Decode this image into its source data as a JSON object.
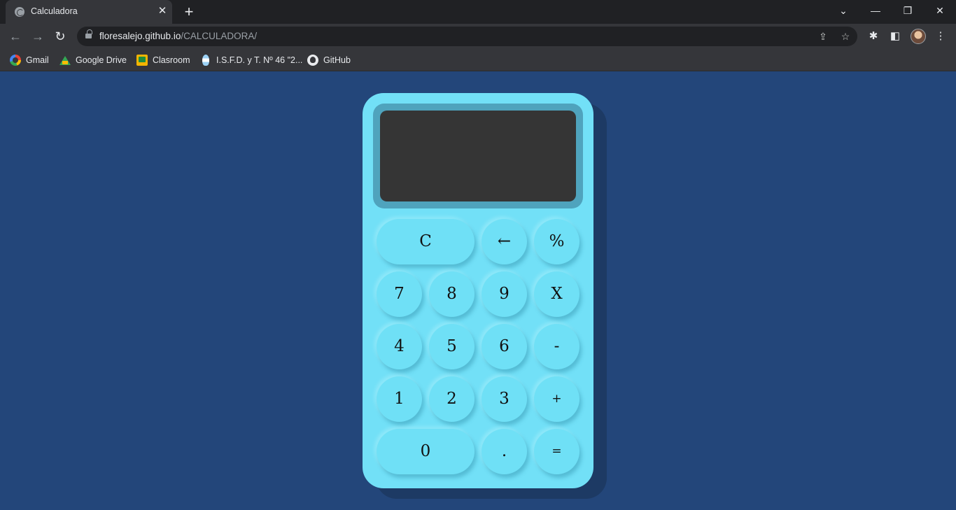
{
  "browser": {
    "tab_title": "Calculadora",
    "tab_close": "✕",
    "new_tab": "+",
    "window": {
      "dropdown": "⌄",
      "minimize": "—",
      "restore": "❐",
      "close": "✕"
    },
    "nav": {
      "back": "←",
      "forward": "→",
      "reload": "↻"
    },
    "url_host": "floresalejo.github.io",
    "url_path": "/CALCULADORA/",
    "omnibox_icons": {
      "share": "⇪",
      "star": "☆"
    },
    "toolbar_icons": {
      "extensions": "✱",
      "side_panel": "◧",
      "menu": "⋮"
    },
    "bookmarks": [
      {
        "label": "Gmail",
        "icon": "google-icon"
      },
      {
        "label": "Google Drive",
        "icon": "google-drive-icon"
      },
      {
        "label": "Clasroom",
        "icon": "classroom-icon"
      },
      {
        "label": "I.S.F.D. y T. Nº 46 \"2...",
        "icon": "isfd-icon"
      },
      {
        "label": "GitHub",
        "icon": "github-icon"
      }
    ]
  },
  "calculator": {
    "display": "",
    "keys": {
      "clear": "C",
      "backspace": "←",
      "percent": "%",
      "seven": "7",
      "eight": "8",
      "nine": "9",
      "multiply": "X",
      "four": "4",
      "five": "5",
      "six": "6",
      "subtract": "-",
      "one": "1",
      "two": "2",
      "three": "3",
      "add": "+",
      "zero": "0",
      "decimal": ".",
      "equals": "="
    }
  },
  "colors": {
    "page_bg": "#23467a",
    "calculator_body": "#72e0f7",
    "display_frame": "#4fa3bd",
    "display_bg": "#353535",
    "key_bg": "#6fe0f6"
  }
}
